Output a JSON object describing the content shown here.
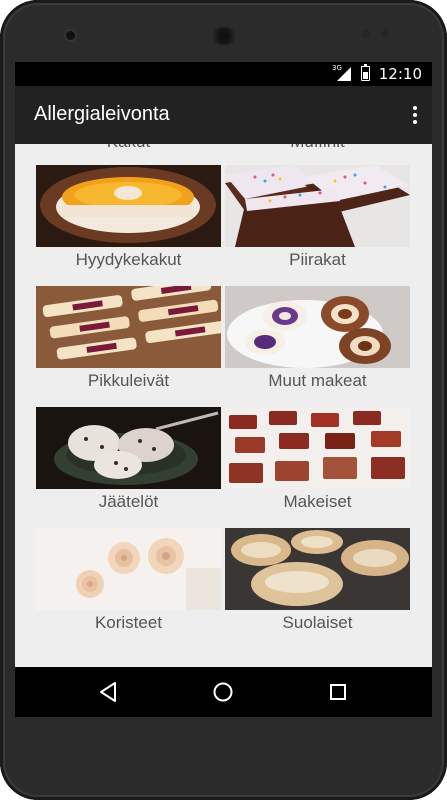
{
  "status": {
    "network": "3G",
    "time": "12:10"
  },
  "appbar": {
    "title": "Allergialeivonta",
    "menu_icon": "more-vert-icon"
  },
  "categories": [
    {
      "label": "Kakut"
    },
    {
      "label": "Muffinit"
    },
    {
      "label": "Hyydykekakut"
    },
    {
      "label": "Piirakat"
    },
    {
      "label": "Pikkuleivät"
    },
    {
      "label": "Muut makeat"
    },
    {
      "label": "Jäätelöt"
    },
    {
      "label": "Makeiset"
    },
    {
      "label": "Koristeet"
    },
    {
      "label": "Suolaiset"
    }
  ],
  "navbar": {
    "back_icon": "back-icon",
    "home_icon": "home-icon",
    "recents_icon": "recents-icon"
  }
}
